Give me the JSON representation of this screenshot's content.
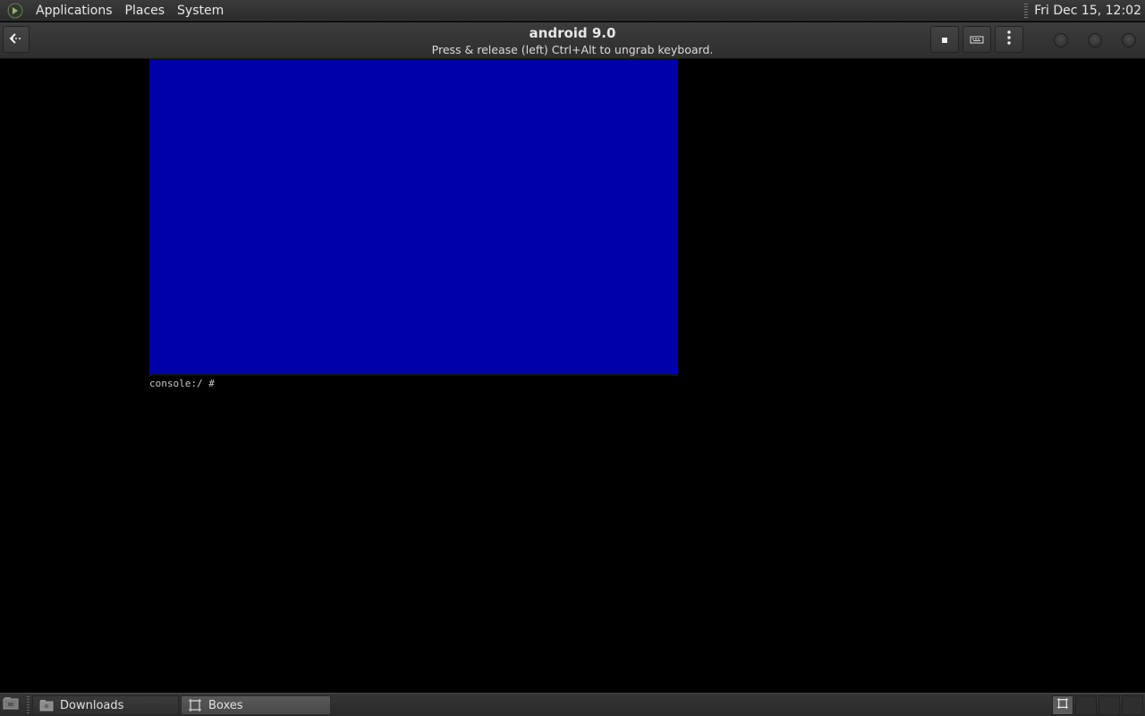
{
  "top_panel": {
    "menus": [
      "Applications",
      "Places",
      "System"
    ],
    "clock": "Fri Dec 15, 12:02"
  },
  "header_bar": {
    "title": "android 9.0",
    "subtitle": "Press & release (left) Ctrl+Alt to ungrab keyboard.",
    "icons": {
      "back": "back-arrow-icon",
      "stop": "stop-icon",
      "keyboard": "keyboard-icon",
      "menu": "kebab-menu-icon"
    }
  },
  "vm_display": {
    "screen_color": "#0000aa",
    "console_prompt": "console:/ #"
  },
  "bottom_panel": {
    "tasks": [
      {
        "label": "Downloads",
        "icon": "folder-icon",
        "active": false
      },
      {
        "label": "Boxes",
        "icon": "boxes-icon",
        "active": true
      }
    ]
  }
}
